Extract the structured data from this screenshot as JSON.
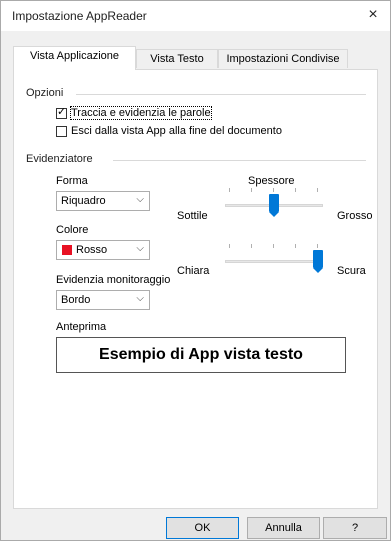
{
  "window": {
    "title": "Impostazione AppReader",
    "close_icon": "×"
  },
  "tabs": [
    {
      "label": "Vista Applicazione",
      "active": true
    },
    {
      "label": "Vista Testo",
      "active": false
    },
    {
      "label": "Impostazioni Condivise",
      "active": false
    }
  ],
  "options": {
    "group_label": "Opzioni",
    "track_words": {
      "label": "Traccia e evidenzia le parole",
      "checked": true
    },
    "exit_app_view": {
      "label": "Esci dalla vista App alla fine del documento",
      "checked": false
    }
  },
  "highlighter": {
    "group_label": "Evidenziatore",
    "shape": {
      "label": "Forma",
      "value": "Riquadro"
    },
    "color": {
      "label": "Colore",
      "value": "Rosso",
      "swatch": "#e81123"
    },
    "monitor_highlight": {
      "label": "Evidenzia monitoraggio",
      "value": "Bordo"
    },
    "thickness": {
      "label": "Spessore",
      "min_label": "Sottile",
      "max_label": "Grosso",
      "level": 0.5
    },
    "opacity": {
      "min_label": "Chiara",
      "max_label": "Scura",
      "level": 1.0
    }
  },
  "preview": {
    "label": "Anteprima",
    "text": "Esempio di App vista testo"
  },
  "buttons": {
    "ok": "OK",
    "cancel": "Annulla",
    "help": "?"
  },
  "colors": {
    "accent": "#0078d7",
    "red": "#e81123"
  }
}
